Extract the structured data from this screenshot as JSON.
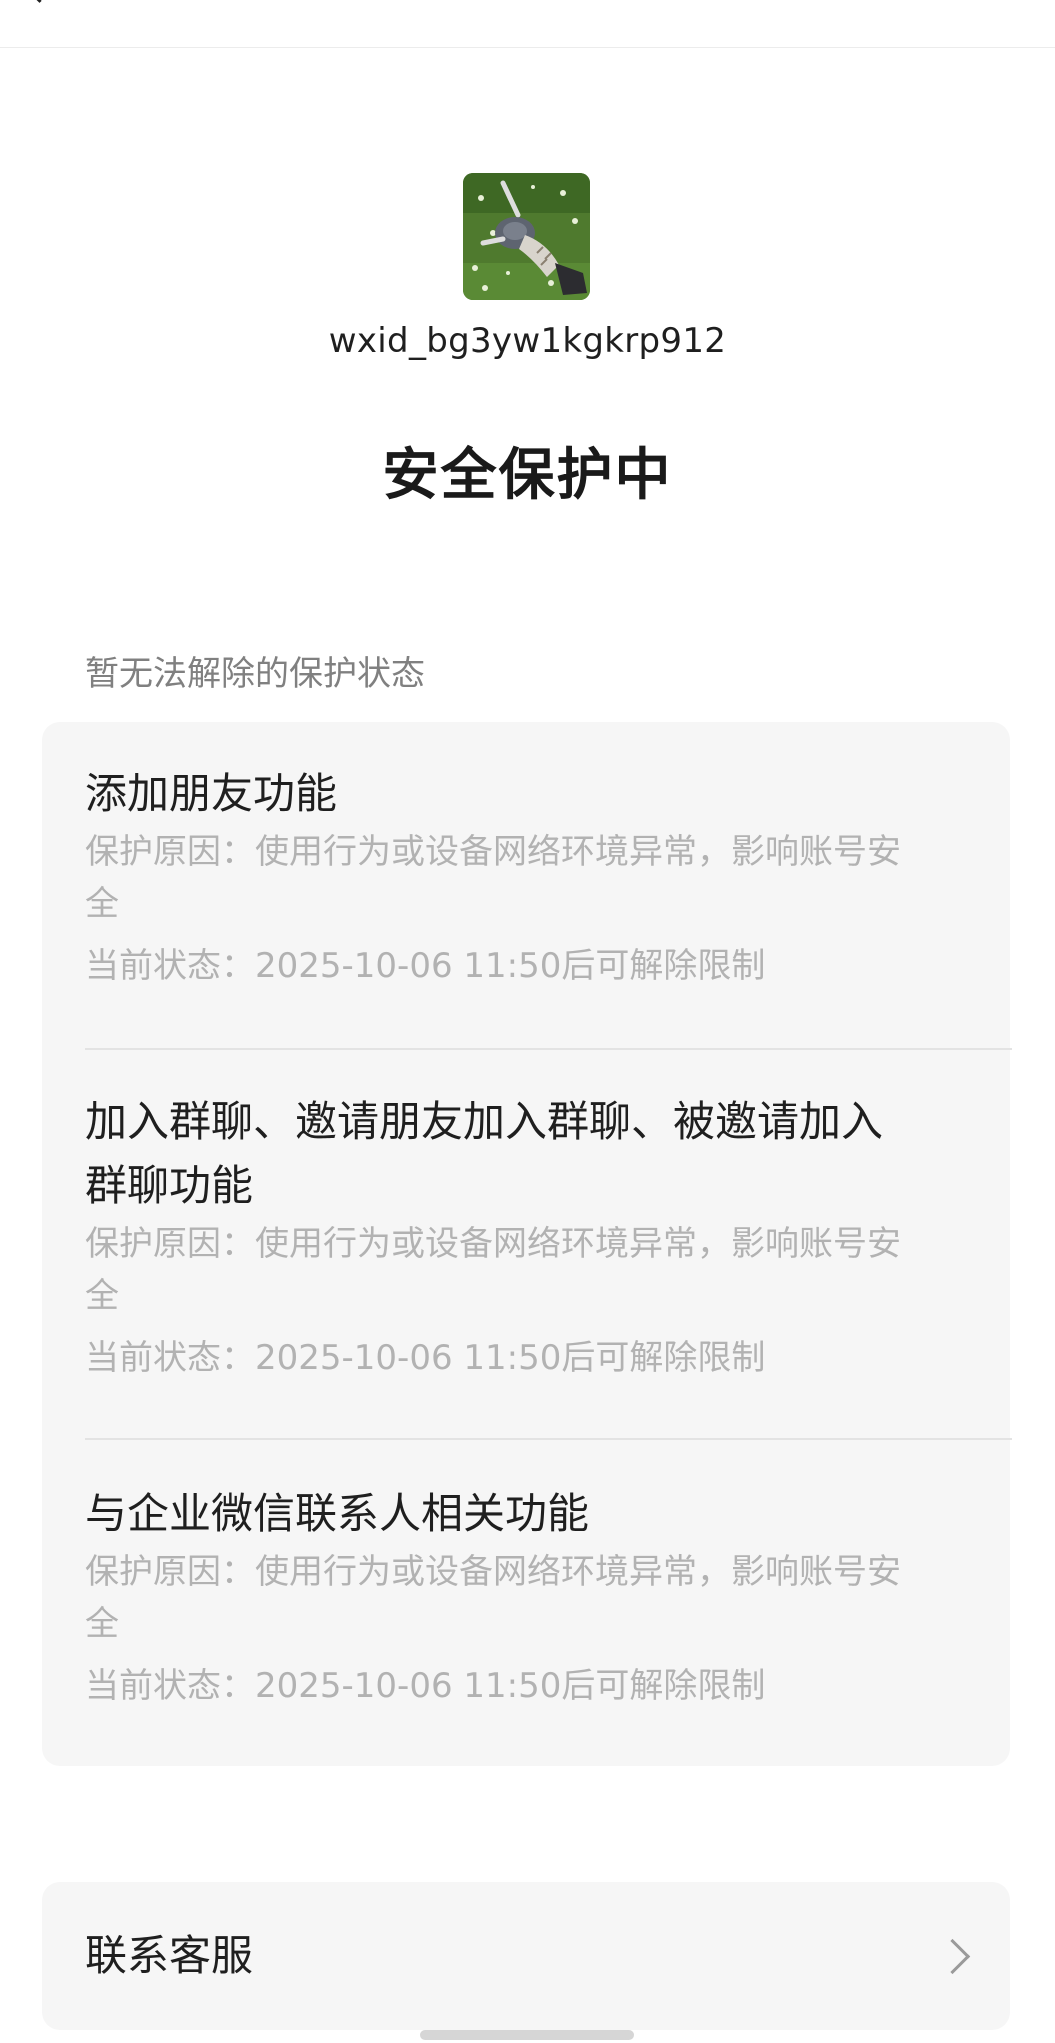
{
  "account": {
    "user_id": "wxid_bg3yw1kgkrp912"
  },
  "page": {
    "title": "安全保护中"
  },
  "protections": {
    "section_label": "暂无法解除的保护状态",
    "items": [
      {
        "title_lines": [
          "添加朋友功能"
        ],
        "reason_lines": [
          "保护原因：使用行为或设备网络环境异常，影响账号安",
          "全"
        ],
        "status": "当前状态：2025-10-06 11:50后可解除限制"
      },
      {
        "title_lines": [
          "加入群聊、邀请朋友加入群聊、被邀请加入",
          "群聊功能"
        ],
        "reason_lines": [
          "保护原因：使用行为或设备网络环境异常，影响账号安",
          "全"
        ],
        "status": "当前状态：2025-10-06 11:50后可解除限制"
      },
      {
        "title_lines": [
          "与企业微信联系人相关功能"
        ],
        "reason_lines": [
          "保护原因：使用行为或设备网络环境异常，影响账号安",
          "全"
        ],
        "status": "当前状态：2025-10-06 11:50后可解除限制"
      }
    ]
  },
  "service": {
    "label": "联系客服"
  },
  "icons": {
    "back": "back-arrow-icon",
    "chevron": "chevron-right-icon"
  },
  "colors": {
    "card_background": "#f6f6f6",
    "muted_text": "#b2b2b2",
    "section_label": "#808080"
  }
}
